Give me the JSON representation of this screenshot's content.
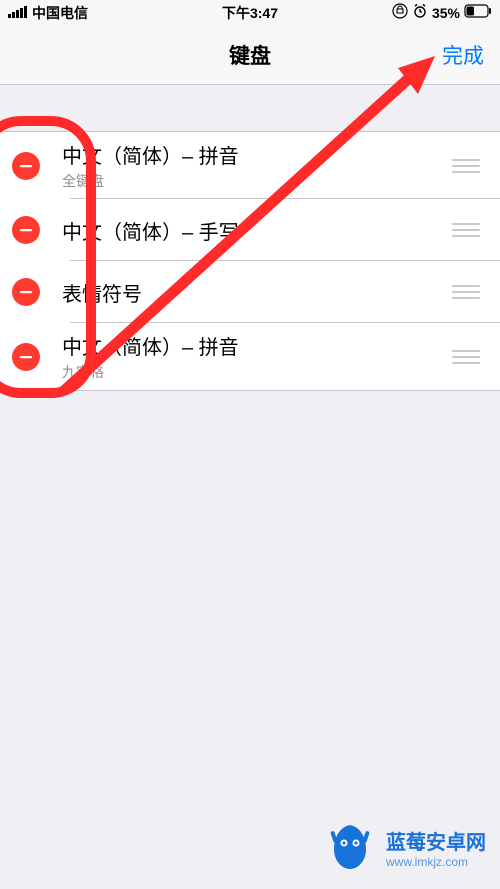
{
  "status_bar": {
    "carrier": "中国电信",
    "time": "下午3:47",
    "battery_percent": "35%"
  },
  "nav": {
    "title": "键盘",
    "done": "完成"
  },
  "keyboards": [
    {
      "title": "中文（简体）– 拼音",
      "subtitle": "全键盘"
    },
    {
      "title": "中文（简体）– 手写",
      "subtitle": ""
    },
    {
      "title": "表情符号",
      "subtitle": ""
    },
    {
      "title": "中文（简体）– 拼音",
      "subtitle": "九宫格"
    }
  ],
  "watermark": {
    "title": "蓝莓安卓网",
    "url": "www.lmkjz.com"
  },
  "colors": {
    "accent_red": "#ff3b30",
    "link_blue": "#007aff",
    "annotation": "#ff2a2a",
    "watermark": "#1872d8"
  }
}
